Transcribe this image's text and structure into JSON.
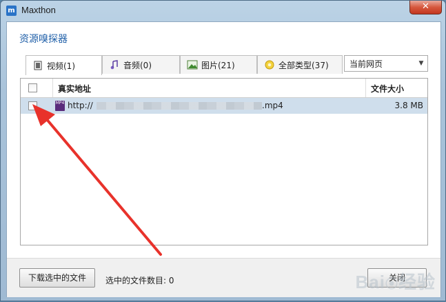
{
  "window": {
    "title": "Maxthon",
    "close_symbol": "✕"
  },
  "dialog": {
    "heading": "资源嗅探器"
  },
  "tabs": [
    {
      "label": "视频(1)",
      "icon": "video-icon",
      "active": true
    },
    {
      "label": "音频(0)",
      "icon": "music-note-icon",
      "active": false
    },
    {
      "label": "图片(21)",
      "icon": "image-icon",
      "active": false
    },
    {
      "label": "全部类型(37)",
      "icon": "all-types-icon",
      "active": false
    }
  ],
  "scope_select": {
    "value": "当前网页"
  },
  "table": {
    "headers": {
      "url": "真实地址",
      "size": "文件大小"
    },
    "rows": [
      {
        "url_prefix": "http://",
        "url_suffix": ".mp4",
        "size": "3.8 MB",
        "icon_label": "MP4",
        "selected": false
      }
    ]
  },
  "footer": {
    "download_label": "下载选中的文件",
    "selected_count_label": "选中的文件数目: 0",
    "close_label": "关闭"
  },
  "annotation": {
    "color": "#e8322b"
  },
  "watermark": "Bai 经验"
}
